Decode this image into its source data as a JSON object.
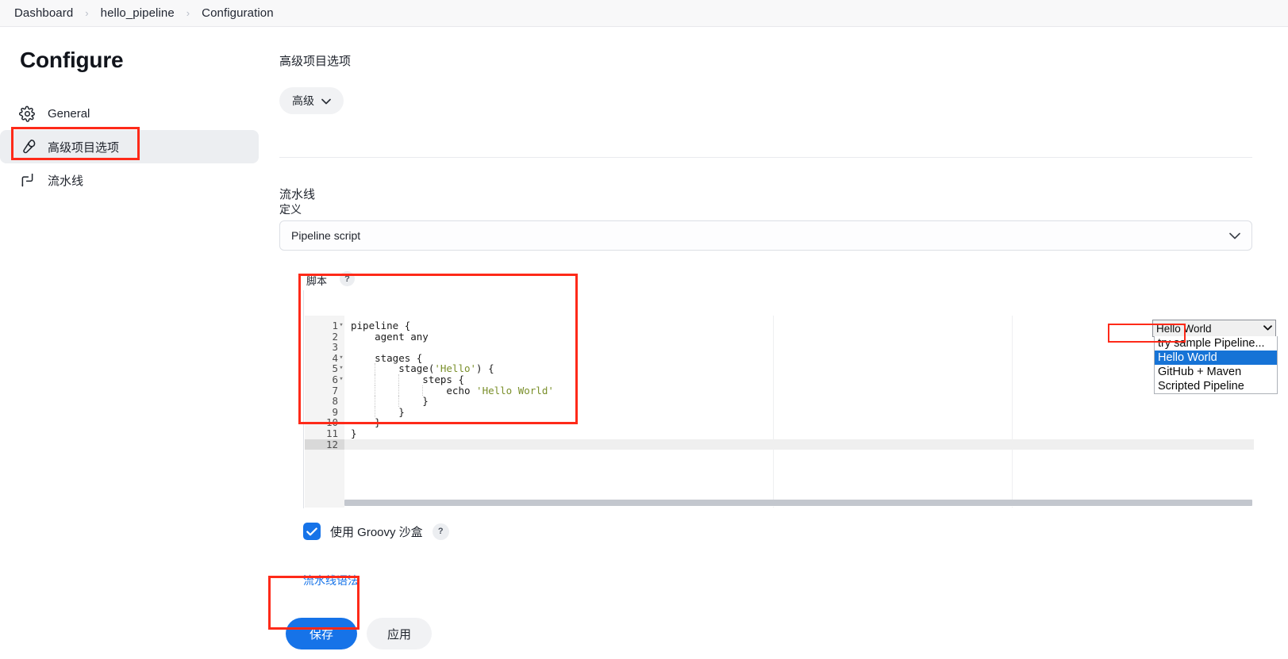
{
  "breadcrumb": {
    "items": [
      {
        "label": "Dashboard"
      },
      {
        "label": "hello_pipeline"
      },
      {
        "label": "Configuration"
      }
    ],
    "separator": "›"
  },
  "sidebar": {
    "title": "Configure",
    "items": [
      {
        "label": "General",
        "icon": "gear-icon",
        "active": false
      },
      {
        "label": "高级项目选项",
        "icon": "wrench-icon",
        "active": true
      },
      {
        "label": "流水线",
        "icon": "pipeline-icon",
        "active": false
      }
    ]
  },
  "main": {
    "advanced_section_title": "高级项目选项",
    "advanced_button_label": "高级",
    "advanced_button_chevron": "⌄",
    "pipeline_section_title": "流水线",
    "definition_label": "定义",
    "definition_value": "Pipeline script",
    "definition_chevron": "⌄",
    "script_label": "脚本",
    "help_badge": "?"
  },
  "editor": {
    "lines": [
      {
        "no": "1",
        "fold": true,
        "text": "pipeline {",
        "active": false
      },
      {
        "no": "2",
        "fold": false,
        "text": "    agent any",
        "active": false
      },
      {
        "no": "3",
        "fold": false,
        "text": "",
        "active": false
      },
      {
        "no": "4",
        "fold": true,
        "text": "    stages {",
        "active": false
      },
      {
        "no": "5",
        "fold": true,
        "text": "        stage('Hello') {",
        "active": false
      },
      {
        "no": "6",
        "fold": true,
        "text": "            steps {",
        "active": false
      },
      {
        "no": "7",
        "fold": false,
        "text": "                echo 'Hello World'",
        "active": false
      },
      {
        "no": "8",
        "fold": false,
        "text": "            }",
        "active": false
      },
      {
        "no": "9",
        "fold": false,
        "text": "        }",
        "active": false
      },
      {
        "no": "10",
        "fold": false,
        "text": "    }",
        "active": false
      },
      {
        "no": "11",
        "fold": false,
        "text": "}",
        "active": false
      },
      {
        "no": "12",
        "fold": false,
        "text": "",
        "active": true
      }
    ],
    "fold_glyph": "▾",
    "strings": [
      "'Hello'",
      "'Hello World'"
    ]
  },
  "sample_select": {
    "value": "Hello World",
    "chevron": "⌄",
    "options": [
      {
        "label": "try sample Pipeline...",
        "selected": false
      },
      {
        "label": "Hello World",
        "selected": true
      },
      {
        "label": "GitHub + Maven",
        "selected": false
      },
      {
        "label": "Scripted Pipeline",
        "selected": false
      }
    ]
  },
  "sandbox": {
    "label": "使用 Groovy 沙盒",
    "checked": true,
    "help": "?"
  },
  "links": {
    "pipeline_syntax": "流水线语法"
  },
  "buttons": {
    "save": "保存",
    "apply": "应用"
  },
  "colors": {
    "accent": "#1673e8",
    "annotation": "#fe2a19",
    "option_highlight": "#1673d6",
    "sidebar_active": "#eceef1",
    "code_string": "#7a8f2a"
  }
}
